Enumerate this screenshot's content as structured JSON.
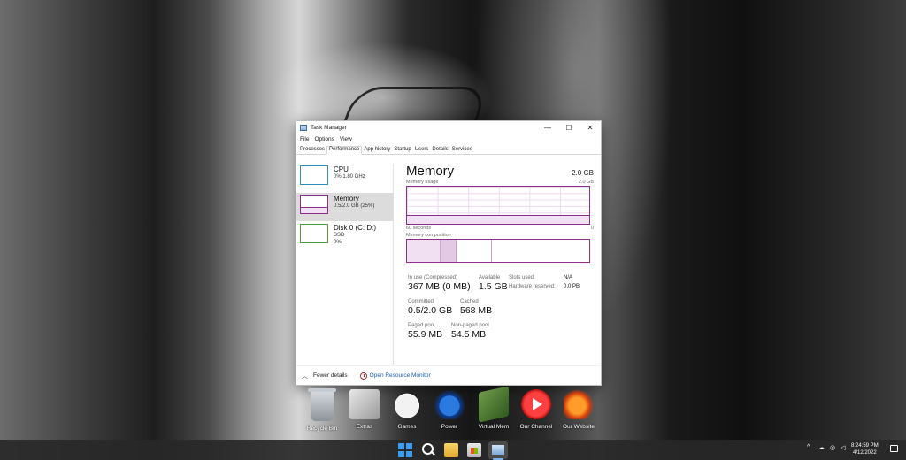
{
  "window": {
    "title": "Task Manager",
    "minimize": "—",
    "maximize": "☐",
    "close": "✕"
  },
  "menu": [
    "File",
    "Options",
    "View"
  ],
  "tabs": [
    "Processes",
    "Performance",
    "App history",
    "Startup",
    "Users",
    "Details",
    "Services"
  ],
  "active_tab": "Performance",
  "sidebar": {
    "items": [
      {
        "name": "CPU",
        "sub1": "0% 1.80 GHz",
        "sub2": ""
      },
      {
        "name": "Memory",
        "sub1": "0.5/2.0 GB (25%)",
        "sub2": ""
      },
      {
        "name": "Disk 0 (C: D:)",
        "sub1": "SSD",
        "sub2": "0%"
      }
    ],
    "selected": "Memory"
  },
  "memory": {
    "title": "Memory",
    "total": "2.0 GB",
    "usage_label": "Memory usage",
    "usage_max": "2.0 GB",
    "axis_left": "60 seconds",
    "axis_right": "0",
    "usage_fraction": 0.25,
    "composition_label": "Memory composition",
    "stats": {
      "in_use_label": "In use (Compressed)",
      "in_use_value": "367 MB (0 MB)",
      "available_label": "Available",
      "available_value": "1.5 GB",
      "committed_label": "Committed",
      "committed_value": "0.5/2.0 GB",
      "cached_label": "Cached",
      "cached_value": "568 MB",
      "paged_label": "Paged pool",
      "paged_value": "55.9 MB",
      "nonpaged_label": "Non-paged pool",
      "nonpaged_value": "54.5 MB",
      "slots_label": "Slots used:",
      "slots_value": "N/A",
      "hw_reserved_label": "Hardware reserved:",
      "hw_reserved_value": "0.0 PB"
    }
  },
  "footer": {
    "fewer_details": "Fewer details",
    "resource_monitor": "Open Resource Monitor"
  },
  "dock": [
    {
      "label": "Recycle Bin",
      "icon": "recycle-bin-icon"
    },
    {
      "label": "Extras",
      "icon": "extras-icon"
    },
    {
      "label": "Games",
      "icon": "game-controller-icon"
    },
    {
      "label": "Power",
      "icon": "power-icon"
    },
    {
      "label": "Virtual Mem",
      "icon": "memory-chip-icon"
    },
    {
      "label": "Our Channel",
      "icon": "play-icon"
    },
    {
      "label": "Our Website",
      "icon": "bird-logo-icon"
    }
  ],
  "taskbar": {
    "time": "8:24:59 PM",
    "date": "4/12/2022",
    "tray_chevron": "^"
  },
  "colors": {
    "memory_accent": "#8b2f8b",
    "cpu_accent": "#2f8dc0",
    "disk_accent": "#4f9a3c",
    "link": "#1a5fb4"
  }
}
